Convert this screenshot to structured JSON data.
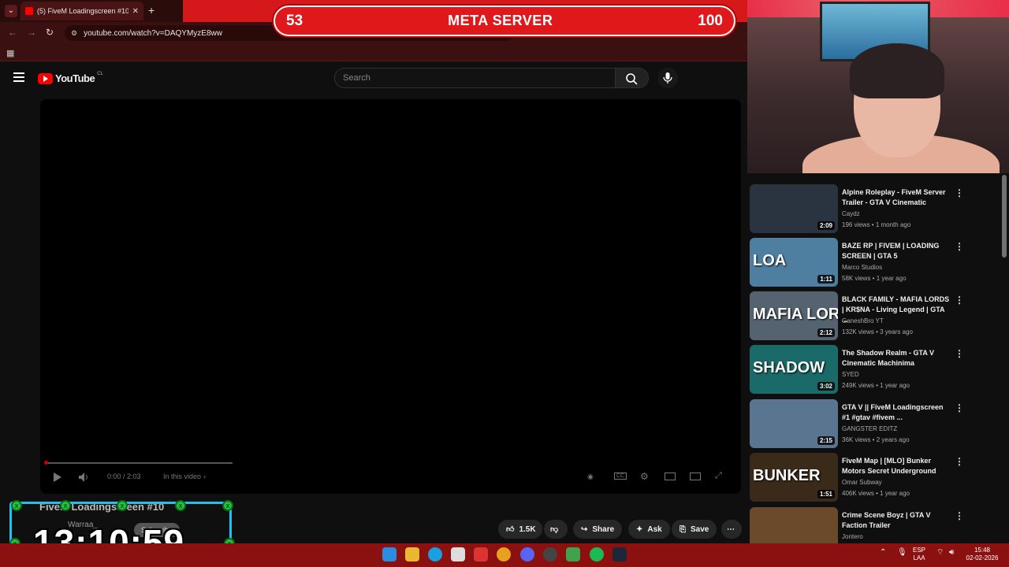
{
  "browser": {
    "tab_title": "(5) FiveM Loadingscreen #10 - ",
    "tab_close": "✕",
    "new_tab": "+",
    "url": "youtube.com/watch?v=DAQYMyzE8ww",
    "back": "←",
    "forward": "→",
    "reload": "↻"
  },
  "overlay_banner": {
    "left_number": "53",
    "title": "META SERVER",
    "right_number": "100"
  },
  "youtube": {
    "logo_text": "YouTube",
    "logo_country": "CL",
    "search_placeholder": "Search"
  },
  "player": {
    "time": "0:00 / 2:03",
    "chapter": "In this video",
    "progress_fraction": 0.0
  },
  "video": {
    "title": "FiveM Loadingscreen #10",
    "channel": "Warraa_",
    "subscribe": "Subscribe",
    "likes": "1.5K",
    "share": "Share",
    "ask": "Ask",
    "save": "Save"
  },
  "timer": {
    "value": "13:10:59"
  },
  "recommendations": [
    {
      "title": "Alpine Roleplay - FiveM Server Trailer - GTA V Cinematic",
      "channel": "Caydz",
      "meta": "196 views • 1 month ago",
      "duration": "2:09",
      "thumb_text": "",
      "thumb_color": "#2a3440"
    },
    {
      "title": "BAZE RP | FIVEM | LOADING SCREEN | GTA 5",
      "channel": "Marco Studios",
      "meta": "58K views • 1 year ago",
      "duration": "1:11",
      "thumb_text": "LOA",
      "thumb_color": "#4f7fa0"
    },
    {
      "title": "BLACK FAMILY - MAFIA LORDS | KR$NA - Living Legend | GTA ...",
      "channel": "GaneshBro YT",
      "meta": "132K views • 3 years ago",
      "duration": "2:12",
      "thumb_text": "MAFIA LORD",
      "thumb_color": "#556270"
    },
    {
      "title": "The Shadow Realm - GTA V Cinematic Machinima",
      "channel": "SYED",
      "meta": "249K views • 1 year ago",
      "duration": "3:02",
      "thumb_text": "SHADOW",
      "thumb_color": "#1a6a6a"
    },
    {
      "title": "GTA V || FiveM Loadingscreen #1 #gtav #fivem ...",
      "channel": "GANGSTER EDITZ",
      "meta": "36K views • 2 years ago",
      "duration": "2:15",
      "thumb_text": "",
      "thumb_color": "#5a7590"
    },
    {
      "title": "FiveM Map | [MLO] Bunker Motors Secret Underground",
      "channel": "Omar Subway",
      "meta": "406K views • 1 year ago",
      "duration": "1:51",
      "thumb_text": "BUNKER",
      "thumb_color": "#3a2a1a"
    },
    {
      "title": "Crime Scene Boyz | GTA V Faction Trailer",
      "channel": "Jontero",
      "meta": "",
      "duration": "",
      "thumb_text": "",
      "thumb_color": "#6a4a2a"
    }
  ],
  "taskbar": {
    "lang_top": "ESP",
    "lang_bottom": "LAA",
    "time": "15:48",
    "date": "02-02-2026"
  },
  "colors": {
    "banner_red": "#e0181c",
    "timer_border": "#20c0f0",
    "taskbar": "#8b1010",
    "youtube_red": "#ff0000"
  }
}
